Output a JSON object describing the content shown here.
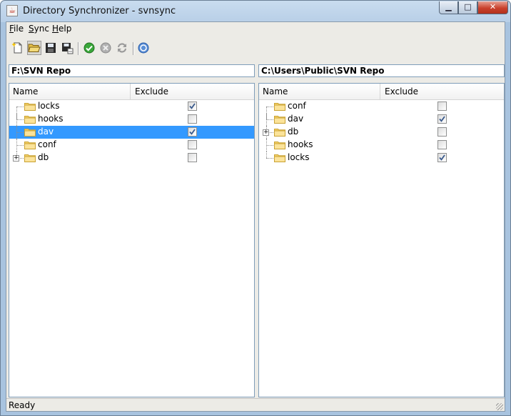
{
  "window": {
    "title": "Directory Synchronizer - svnsync",
    "min_glyph": "▁",
    "max_glyph": "□",
    "close_glyph": "✕"
  },
  "menu": [
    {
      "mnemonic": "F",
      "rest": "ile"
    },
    {
      "mnemonic": "S",
      "rest": "ync"
    },
    {
      "mnemonic": "H",
      "rest": "elp"
    }
  ],
  "toolbar": [
    {
      "icon": "new-icon"
    },
    {
      "icon": "open-folder-icon"
    },
    {
      "icon": "save-icon"
    },
    {
      "icon": "save-as-icon"
    },
    {
      "icon": "check-icon"
    },
    {
      "icon": "stop-icon"
    },
    {
      "icon": "sync-icon"
    },
    {
      "icon": "help-icon"
    }
  ],
  "left": {
    "path": "F:\\SVN Repo",
    "columns": {
      "name": "Name",
      "exclude": "Exclude"
    },
    "rows": [
      {
        "name": "locks",
        "excluded": true,
        "expandable": false,
        "selected": false
      },
      {
        "name": "hooks",
        "excluded": false,
        "expandable": false,
        "selected": false
      },
      {
        "name": "dav",
        "excluded": true,
        "expandable": false,
        "selected": true
      },
      {
        "name": "conf",
        "excluded": false,
        "expandable": false,
        "selected": false
      },
      {
        "name": "db",
        "excluded": false,
        "expandable": true,
        "selected": false
      }
    ]
  },
  "right": {
    "path": "C:\\Users\\Public\\SVN Repo",
    "columns": {
      "name": "Name",
      "exclude": "Exclude"
    },
    "rows": [
      {
        "name": "conf",
        "excluded": false,
        "expandable": false,
        "selected": false
      },
      {
        "name": "dav",
        "excluded": true,
        "expandable": false,
        "selected": false
      },
      {
        "name": "db",
        "excluded": false,
        "expandable": true,
        "selected": false
      },
      {
        "name": "hooks",
        "excluded": false,
        "expandable": false,
        "selected": false
      },
      {
        "name": "locks",
        "excluded": true,
        "expandable": false,
        "selected": false
      }
    ]
  },
  "status": "Ready",
  "colors": {
    "selection": "#3399ff",
    "check": "#3a5a8c"
  }
}
